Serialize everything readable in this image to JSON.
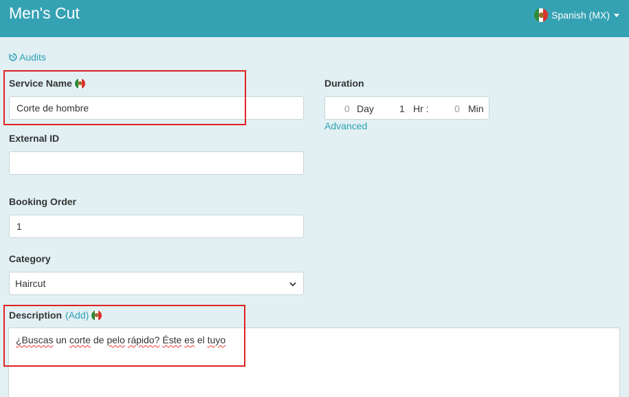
{
  "header": {
    "title": "Men's Cut",
    "language": "Spanish (MX)"
  },
  "audits_link": "Audits",
  "service_name": {
    "label": "Service Name",
    "value": "Corte de hombre"
  },
  "duration": {
    "label": "Duration",
    "day_value": "0",
    "day_unit": "Day",
    "hr_value": "1",
    "hr_unit": "Hr :",
    "min_value": "0",
    "min_unit": "Min",
    "advanced_link": "Advanced"
  },
  "external_id": {
    "label": "External ID",
    "value": ""
  },
  "booking_order": {
    "label": "Booking Order",
    "value": "1"
  },
  "category": {
    "label": "Category",
    "selected": "Haircut"
  },
  "description": {
    "label": "Description",
    "add_link": "(Add)",
    "words": [
      "¿Buscas",
      "un",
      "corte",
      "de",
      "pelo",
      "rápido?",
      "Éste",
      "es",
      "el",
      "tuyo"
    ],
    "value": "¿Buscas un corte de pelo rápido? Éste es el tuyo"
  },
  "colors": {
    "header_bg": "#35a2b3",
    "page_bg": "#e2f0f3",
    "link": "#2e9fb5",
    "highlight": "#e02020"
  },
  "icons": [
    "mexico-flag-icon",
    "history-icon",
    "caret-down-icon",
    "chevron-down-icon"
  ]
}
